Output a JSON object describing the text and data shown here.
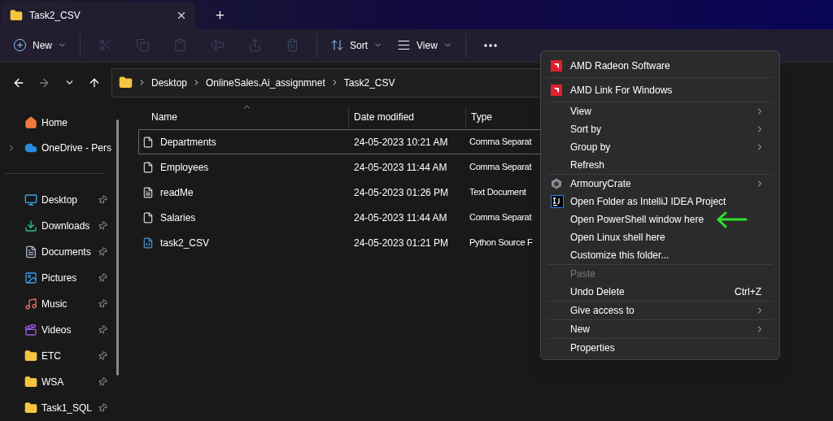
{
  "tab": {
    "title": "Task2_CSV"
  },
  "toolbar": [
    {
      "kind": "new",
      "label": "New",
      "disabled": false
    },
    {
      "kind": "cut",
      "disabled": true
    },
    {
      "kind": "copy",
      "disabled": true
    },
    {
      "kind": "paste",
      "disabled": true
    },
    {
      "kind": "rename",
      "disabled": true
    },
    {
      "kind": "share",
      "disabled": true
    },
    {
      "kind": "delete",
      "disabled": true
    },
    {
      "kind": "sort",
      "label": "Sort",
      "disabled": false
    },
    {
      "kind": "view",
      "label": "View",
      "disabled": false
    },
    {
      "kind": "more",
      "disabled": false
    }
  ],
  "navigation": [
    {
      "kind": "back",
      "disabled": false
    },
    {
      "kind": "forward",
      "disabled": true
    },
    {
      "kind": "recent",
      "disabled": false
    },
    {
      "kind": "up",
      "disabled": false
    }
  ],
  "breadcrumbs": [
    "Desktop",
    "OnlineSales.Ai_assignmnet",
    "Task2_CSV"
  ],
  "sidebar": {
    "top": [
      {
        "kind": "home",
        "label": "Home",
        "expandable": false
      },
      {
        "kind": "cloud",
        "label": "OneDrive - Pers",
        "expandable": true
      }
    ],
    "quick_access": [
      {
        "kind": "desktop",
        "label": "Desktop",
        "pinned": true
      },
      {
        "kind": "downloads",
        "label": "Downloads",
        "pinned": true
      },
      {
        "kind": "documents",
        "label": "Documents",
        "pinned": true
      },
      {
        "kind": "pictures",
        "label": "Pictures",
        "pinned": true
      },
      {
        "kind": "music",
        "label": "Music",
        "pinned": true
      },
      {
        "kind": "videos",
        "label": "Videos",
        "pinned": true
      },
      {
        "kind": "folder",
        "label": "ETC",
        "pinned": true
      },
      {
        "kind": "folder",
        "label": "WSA",
        "pinned": true
      },
      {
        "kind": "folder",
        "label": "Task1_SQL",
        "pinned": true
      }
    ]
  },
  "table": {
    "columns": [
      "Name",
      "Date modified",
      "Type"
    ],
    "rows": [
      {
        "kind": "csv",
        "name": "Departments",
        "date": "24-05-2023 10:21 AM",
        "type": "Comma Separat",
        "focused": true
      },
      {
        "kind": "csv",
        "name": "Employees",
        "date": "24-05-2023 11:44 AM",
        "type": "Comma Separat",
        "focused": false
      },
      {
        "kind": "text",
        "name": "readMe",
        "date": "24-05-2023 01:26 PM",
        "type": "Text Document",
        "focused": false
      },
      {
        "kind": "csv",
        "name": "Salaries",
        "date": "24-05-2023 11:44 AM",
        "type": "Comma Separat",
        "focused": false
      },
      {
        "kind": "python",
        "name": "task2_CSV",
        "date": "24-05-2023 01:21 PM",
        "type": "Python Source F",
        "focused": false
      }
    ]
  },
  "context_menu": [
    [
      {
        "kind": "amd",
        "label": "AMD Radeon Software",
        "submenu": false,
        "disabled": false
      }
    ],
    [
      {
        "kind": "amd",
        "label": "AMD Link For Windows",
        "submenu": false,
        "disabled": false
      }
    ],
    [
      {
        "kind": "command",
        "label": "View",
        "submenu": true,
        "disabled": false
      },
      {
        "kind": "command",
        "label": "Sort by",
        "submenu": true,
        "disabled": false
      },
      {
        "kind": "command",
        "label": "Group by",
        "submenu": true,
        "disabled": false
      },
      {
        "kind": "command",
        "label": "Refresh",
        "submenu": false,
        "disabled": false
      }
    ],
    [
      {
        "kind": "armoury",
        "label": "ArmouryCrate",
        "submenu": true,
        "disabled": false
      },
      {
        "kind": "intellij",
        "label": "Open Folder as IntelliJ IDEA Project",
        "submenu": false,
        "disabled": false
      },
      {
        "kind": "command",
        "label": "Open PowerShell window here",
        "submenu": false,
        "disabled": false,
        "annotated": true
      },
      {
        "kind": "command",
        "label": "Open Linux shell here",
        "submenu": false,
        "disabled": false
      },
      {
        "kind": "command",
        "label": "Customize this folder...",
        "submenu": false,
        "disabled": false
      }
    ],
    [
      {
        "kind": "command",
        "label": "Paste",
        "submenu": false,
        "disabled": true
      },
      {
        "kind": "command",
        "label": "Undo Delete",
        "shortcut": "Ctrl+Z",
        "submenu": false,
        "disabled": false
      }
    ],
    [
      {
        "kind": "command",
        "label": "Give access to",
        "submenu": true,
        "disabled": false
      }
    ],
    [
      {
        "kind": "command",
        "label": "New",
        "submenu": true,
        "disabled": false
      }
    ],
    [
      {
        "kind": "command",
        "label": "Properties",
        "submenu": false,
        "disabled": false
      }
    ]
  ]
}
